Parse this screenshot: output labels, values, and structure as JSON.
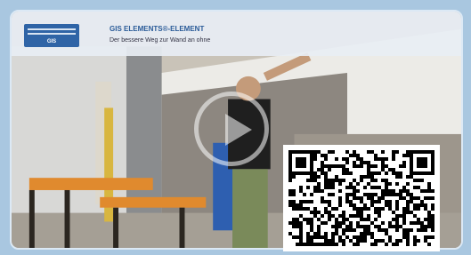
{
  "video": {
    "logo_text": "GIS",
    "title": "GIS ELEMENTS®-ELEMENT",
    "subtitle": "Der bessere Weg zur Wand an ohne",
    "play_icon": "play-icon",
    "qr_icon": "qr-code-icon"
  }
}
